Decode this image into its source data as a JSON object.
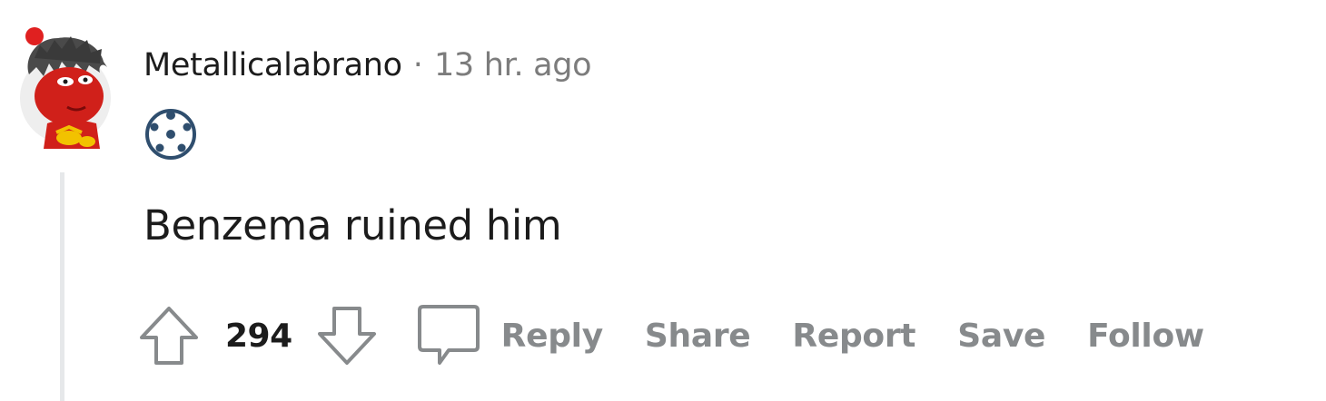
{
  "comment": {
    "username": "Metallicalabrano",
    "separator": "·",
    "timestamp": "13 hr. ago",
    "flair_icon": "soccer-ball-icon",
    "avatar_icon": "red-devil-avatar-icon",
    "body": "Benzema ruined him",
    "score": "294"
  },
  "actions": {
    "reply": "Reply",
    "share": "Share",
    "report": "Report",
    "save": "Save",
    "follow": "Follow"
  },
  "colors": {
    "text_primary": "#1c1c1c",
    "text_secondary": "#7c7c7c",
    "action_gray": "#878a8c",
    "thread_line": "#e6e8ea",
    "avatar_red": "#d0201a"
  }
}
